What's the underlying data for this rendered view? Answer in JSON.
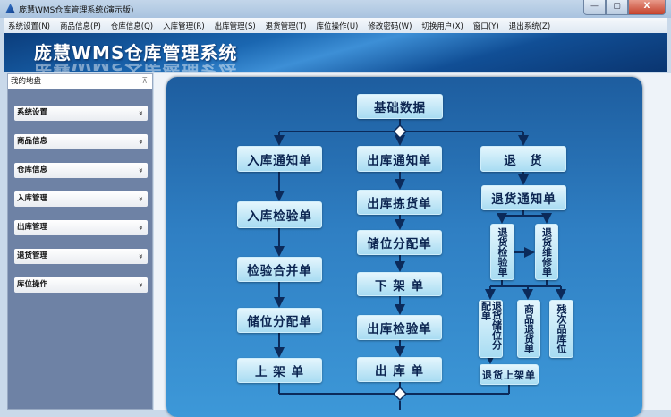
{
  "window": {
    "title": "庞慧WMS仓库管理系统(演示版)",
    "minimize": "—",
    "maximize": "▢",
    "close": "X"
  },
  "menu": [
    "系统设置(N)",
    "商品信息(P)",
    "仓库信息(Q)",
    "入库管理(R)",
    "出库管理(S)",
    "退货管理(T)",
    "库位操作(U)",
    "修改密码(W)",
    "切换用户(X)",
    "窗口(Y)",
    "退出系统(Z)"
  ],
  "banner": {
    "title": "庞慧WMS仓库管理系统"
  },
  "sidebar": {
    "title": "我的地盘",
    "pin": "⊼",
    "items": [
      "系统设置",
      "商品信息",
      "仓库信息",
      "入库管理",
      "出库管理",
      "退货管理",
      "库位操作"
    ],
    "chevron": "»"
  },
  "flow": {
    "root": "基础数据",
    "inbound": [
      "入库通知单",
      "入库检验单",
      "检验合并单",
      "储位分配单",
      "上 架 单"
    ],
    "outbound": [
      "出库通知单",
      "出库拣货单",
      "储位分配单",
      "下 架 单",
      "出库检验单",
      "出 库 单"
    ],
    "returns": {
      "head": "退　货",
      "notice": "退货通知单",
      "inspect": "退货检验单",
      "repair": "退货维修单",
      "allocate": "退货储位分配单",
      "goods_return": "商品退货单",
      "defect": "残次品库位",
      "shelve": "退货上架单"
    }
  },
  "colors": {
    "line": "#0b2a5a",
    "box_text": "#0b2450"
  }
}
